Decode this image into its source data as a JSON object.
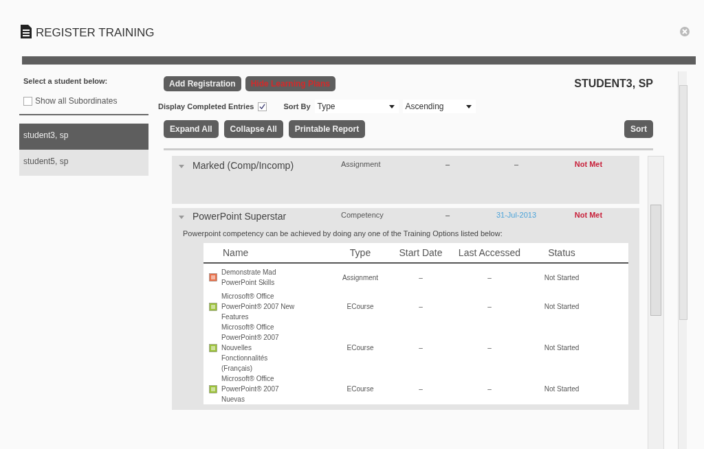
{
  "window": {
    "title": "REGISTER TRAINING"
  },
  "sidebar": {
    "heading": "Select a student below:",
    "show_all": {
      "label": "Show all Subordinates",
      "checked": false
    },
    "students": [
      {
        "name": "student3, sp",
        "selected": true
      },
      {
        "name": "student5, sp",
        "selected": false
      }
    ]
  },
  "toolbar": {
    "buttons": [
      {
        "label": "Add Registration",
        "kind": "normal"
      },
      {
        "label": "Hide Learning Plans",
        "kind": "alert"
      }
    ],
    "student_name": "STUDENT3, SP",
    "display_completed": {
      "label": "Display Completed Entries",
      "checked": true
    },
    "sort_by": {
      "label": "Sort By",
      "field": "Type",
      "order": "Ascending"
    },
    "actions": [
      "Expand All",
      "Collapse All",
      "Printable Report"
    ],
    "sort_button": "Sort"
  },
  "entries": [
    {
      "name": "Marked (Comp/Incomp)",
      "type": "Assignment",
      "start": "–",
      "accessed": "–",
      "accessed_link": false,
      "status": "Not Met",
      "expanded": true
    },
    {
      "name": "PowerPoint Superstar",
      "type": "Competency",
      "start": "–",
      "accessed": "31-Jul-2013",
      "accessed_link": true,
      "status": "Not Met",
      "expanded": true,
      "description": "Powerpoint competency can be achieved by doing any one of the Training Options listed below:",
      "options": {
        "columns": [
          "Name",
          "Type",
          "Start Date",
          "Last Accessed",
          "Status"
        ],
        "rows": [
          {
            "kind": "assignment",
            "name": "Demonstrate Mad PowerPoint Skills",
            "type": "Assignment",
            "start": "–",
            "accessed": "–",
            "status": "Not Started"
          },
          {
            "kind": "ecourse",
            "name": "Microsoft® Office PowerPoint® 2007 New Features",
            "type": "ECourse",
            "start": "–",
            "accessed": "–",
            "status": "Not Started"
          },
          {
            "kind": "ecourse",
            "name": "Microsoft® Office PowerPoint® 2007 Nouvelles Fonctionnalités (Français)",
            "type": "ECourse",
            "start": "–",
            "accessed": "–",
            "status": "Not Started"
          },
          {
            "kind": "ecourse",
            "name": "Microsoft® Office PowerPoint® 2007 Nuevas",
            "type": "ECourse",
            "start": "–",
            "accessed": "–",
            "status": "Not Started"
          }
        ]
      }
    }
  ]
}
